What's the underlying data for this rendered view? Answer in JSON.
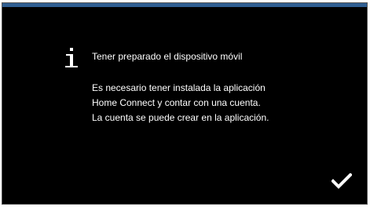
{
  "dialog": {
    "accent_color": "#2f5e91",
    "background_color": "#000000",
    "text_color": "#ffffff",
    "icon": "info-icon",
    "title": "Tener preparado el dispositivo móvil",
    "body_lines": [
      "Es necesario tener instalada la aplicación",
      "Home Connect y contar con una cuenta.",
      "La cuenta se puede crear en la aplicación."
    ],
    "confirm_icon": "checkmark-icon"
  }
}
